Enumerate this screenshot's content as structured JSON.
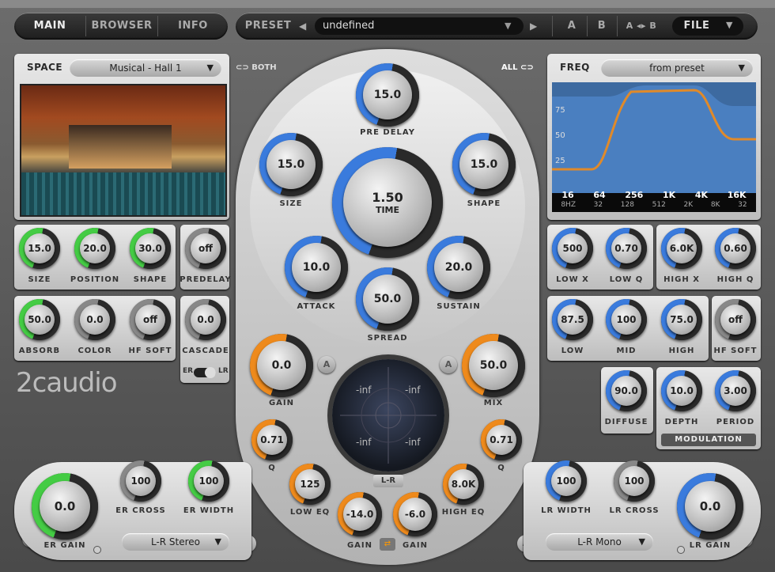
{
  "tabs": {
    "main": "MAIN",
    "browser": "BROWSER",
    "info": "INFO"
  },
  "preset": {
    "label": "PRESET",
    "value": "undefined",
    "a": "A",
    "b": "B",
    "ab": "A ◂▸ B",
    "file": "FILE"
  },
  "space": {
    "title": "SPACE",
    "dropdown": "Musical - Hall 1"
  },
  "both_label": "BOTH",
  "all_label": "ALL",
  "freq": {
    "title": "FREQ",
    "dropdown": "from preset",
    "y_ticks": [
      "75",
      "50",
      "25"
    ],
    "x_ticks_top": [
      "16",
      "64",
      "256",
      "1K",
      "4K",
      "16K"
    ],
    "x_ticks_bottom": [
      "8HZ",
      "32",
      "128",
      "512",
      "2K",
      "8K",
      "32"
    ]
  },
  "left_knobs": [
    {
      "label": "SIZE",
      "value": "15.0",
      "color": "#44cc44"
    },
    {
      "label": "POSITION",
      "value": "20.0",
      "color": "#44cc44"
    },
    {
      "label": "SHAPE",
      "value": "30.0",
      "color": "#44cc44"
    },
    {
      "label": "PREDELAY",
      "value": "off",
      "color": "#888888"
    },
    {
      "label": "ABSORB",
      "value": "50.0",
      "color": "#44cc44"
    },
    {
      "label": "COLOR",
      "value": "0.0",
      "color": "#888888"
    },
    {
      "label": "HF SOFT",
      "value": "off",
      "color": "#888888"
    },
    {
      "label": "CASCADE",
      "value": "0.0",
      "color": "#888888"
    }
  ],
  "er_lr": {
    "er": "ER",
    "lr": "LR"
  },
  "logo": "2caudio",
  "center": {
    "pre_delay": {
      "label": "PRE DELAY",
      "value": "15.0"
    },
    "size": {
      "label": "SIZE",
      "value": "15.0"
    },
    "shape": {
      "label": "SHAPE",
      "value": "15.0"
    },
    "time": {
      "label": "TIME",
      "value": "1.50"
    },
    "attack": {
      "label": "ATTACK",
      "value": "10.0"
    },
    "sustain": {
      "label": "SUSTAIN",
      "value": "20.0"
    },
    "spread": {
      "label": "SPREAD",
      "value": "50.0"
    },
    "gain": {
      "label": "GAIN",
      "value": "0.0"
    },
    "mix": {
      "label": "MIX",
      "value": "50.0"
    },
    "q_left": {
      "label": "Q",
      "value": "0.71"
    },
    "q_right": {
      "label": "Q",
      "value": "0.71"
    },
    "low_eq": {
      "label": "LOW EQ",
      "value": "125"
    },
    "high_eq": {
      "label": "HIGH EQ",
      "value": "8.0K"
    },
    "gain_low": {
      "label": "GAIN",
      "value": "-14.0"
    },
    "gain_high": {
      "label": "GAIN",
      "value": "-6.0"
    },
    "radar": {
      "tl": "-inf",
      "tr": "-inf",
      "bl": "-inf",
      "br": "-inf"
    },
    "lr_button": "L-R"
  },
  "right_knobs": [
    {
      "label": "LOW X",
      "value": "500",
      "color": "#3a7bdd"
    },
    {
      "label": "LOW Q",
      "value": "0.70",
      "color": "#3a7bdd"
    },
    {
      "label": "HIGH X",
      "value": "6.0K",
      "color": "#3a7bdd"
    },
    {
      "label": "HIGH Q",
      "value": "0.60",
      "color": "#3a7bdd"
    },
    {
      "label": "LOW",
      "value": "87.5",
      "color": "#3a7bdd"
    },
    {
      "label": "MID",
      "value": "100",
      "color": "#3a7bdd"
    },
    {
      "label": "HIGH",
      "value": "75.0",
      "color": "#3a7bdd"
    },
    {
      "label": "HF SOFT",
      "value": "off",
      "color": "#888888"
    },
    {
      "label": "DIFFUSE",
      "value": "90.0",
      "color": "#3a7bdd"
    },
    {
      "label": "DEPTH",
      "value": "10.0",
      "color": "#3a7bdd"
    },
    {
      "label": "PERIOD",
      "value": "3.00",
      "color": "#3a7bdd"
    }
  ],
  "modulation_label": "MODULATION",
  "bottom_left": {
    "er_gain": {
      "label": "ER GAIN",
      "value": "0.0"
    },
    "er_cross": {
      "label": "ER CROSS",
      "value": "100"
    },
    "er_width": {
      "label": "ER WIDTH",
      "value": "100"
    },
    "dropdown": "L-R Stereo"
  },
  "bottom_right": {
    "lr_gain": {
      "label": "LR GAIN",
      "value": "0.0"
    },
    "lr_width": {
      "label": "LR WIDTH",
      "value": "100"
    },
    "lr_cross": {
      "label": "LR CROSS",
      "value": "100"
    },
    "dropdown": "L-R Mono"
  },
  "colors": {
    "green": "#44cc44",
    "blue": "#3a7bdd",
    "orange": "#ee8a1c"
  }
}
